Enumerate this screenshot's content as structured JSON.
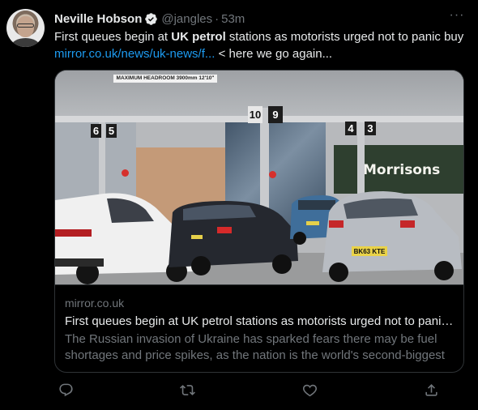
{
  "tweet": {
    "author_name": "Neville Hobson",
    "handle": "@jangles",
    "separator": "·",
    "time": "53m",
    "more": "···",
    "text_before": "First queues begin at ",
    "text_bold": "UK petrol",
    "text_after": " stations as motorists urged not to panic buy",
    "link": "mirror.co.uk/news/uk-news/f...",
    "text_tail": " < here we go again..."
  },
  "card": {
    "image_alt": "Cars queueing at a Morrisons petrol station",
    "image_labels": {
      "headroom_sign": "MAXIMUM HEADROOM 3900mm 12'10\"",
      "pump_6": "6",
      "pump_5": "5",
      "pump_10": "10",
      "pump_9": "9",
      "pump_4": "4",
      "pump_3": "3",
      "store": "Morrisons",
      "plate": "BK63 KTE"
    },
    "domain": "mirror.co.uk",
    "title": "First queues begin at UK petrol stations as motorists urged not to panic buy",
    "description": "The Russian invasion of Ukraine has sparked fears there may be fuel shortages and price spikes, as the nation is the world's second-biggest exporter of crude oil"
  },
  "actions": [
    {
      "name": "reply",
      "icon": "reply-icon"
    },
    {
      "name": "retweet",
      "icon": "retweet-icon"
    },
    {
      "name": "like",
      "icon": "heart-icon"
    },
    {
      "name": "share",
      "icon": "share-icon"
    }
  ],
  "colors": {
    "background": "#000000",
    "text": "#e7e9ea",
    "secondary": "#71767b",
    "link": "#1d9bf0",
    "border": "#2f3336"
  }
}
